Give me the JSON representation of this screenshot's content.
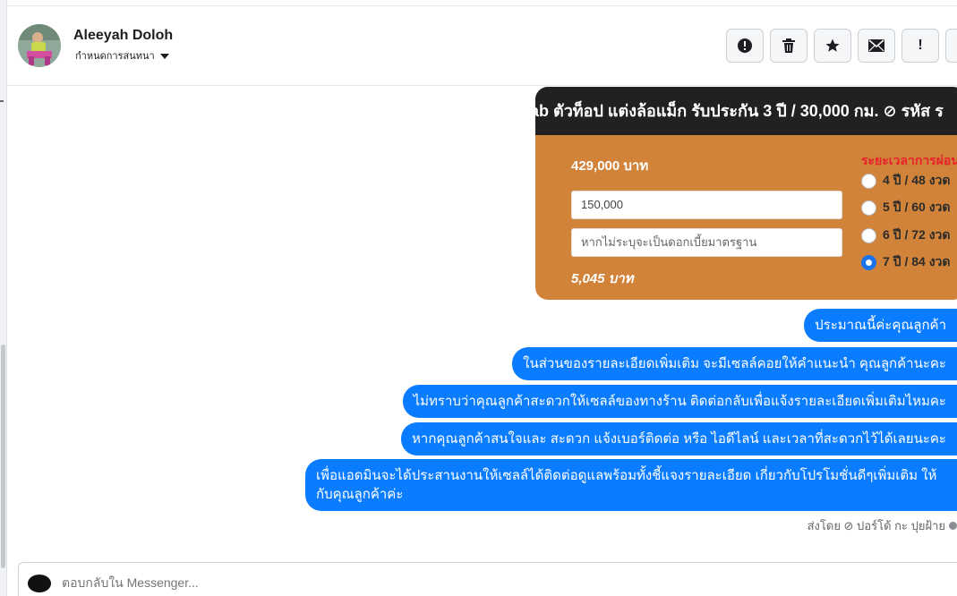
{
  "contact": {
    "name": "Aleeyah Doloh",
    "assign_label": "กำหนดการสนทนา"
  },
  "actions": [
    {
      "name": "report-icon",
      "glyph": "●"
    },
    {
      "name": "delete-icon",
      "glyph": "🗑"
    },
    {
      "name": "star-icon",
      "glyph": "★"
    },
    {
      "name": "mail-icon",
      "glyph": "✉"
    },
    {
      "name": "mark-important-icon",
      "glyph": "!"
    }
  ],
  "offer": {
    "headline": "ab ตัวท็อป แต่งล้อแม็ก รับประกัน 3 ปี / 30,000 กม. ⊘ รหัส ร",
    "price": "429,000 บาท",
    "down_payment": "150,000",
    "rate_placeholder": "หากไม่ระบุจะเป็นดอกเบี้ยมาตรฐาน",
    "monthly": "5,045 บาท",
    "term_title": "ระยะเวลาการผ่อน",
    "terms": [
      {
        "label": "4 ปี / 48 งวด",
        "selected": false
      },
      {
        "label": "5 ปี / 60 งวด",
        "selected": false
      },
      {
        "label": "6 ปี / 72 งวด",
        "selected": false
      },
      {
        "label": "7 ปี / 84 งวด",
        "selected": true
      }
    ]
  },
  "messages": [
    "ประมาณนี้ค่ะคุณลูกค้า",
    "ในส่วนของรายละเอียดเพิ่มเติม จะมีเซลล์คอยให้คำแนะนำ คุณลูกค้านะคะ",
    "ไม่ทราบว่าคุณลูกค้าสะดวกให้เซลล์ของทางร้าน ติดต่อกลับเพื่อแจ้งรายละเอียดเพิ่มเติมไหมคะ",
    "หากคุณลูกค้าสนใจและ สะดวก แจ้งเบอร์ติดต่อ หรือ ไอดีไลน์ และเวลาที่สะดวกไว้ได้เลยนะคะ",
    "เพื่อแอดมินจะได้ประสานงานให้เซลล์ได้ติดต่อดูแลพร้อมทั้งชี้แจงรายละเอียด เกี่ยวกับโปรโมชั่นดีๆเพิ่มเติม ให้กับคุณลูกค้าค่ะ"
  ],
  "sent_by": "ส่งโดย ⊘ ปอร์โด้ กะ ปุยฝ้าย",
  "reply_placeholder": "ตอบกลับใน Messenger..."
}
